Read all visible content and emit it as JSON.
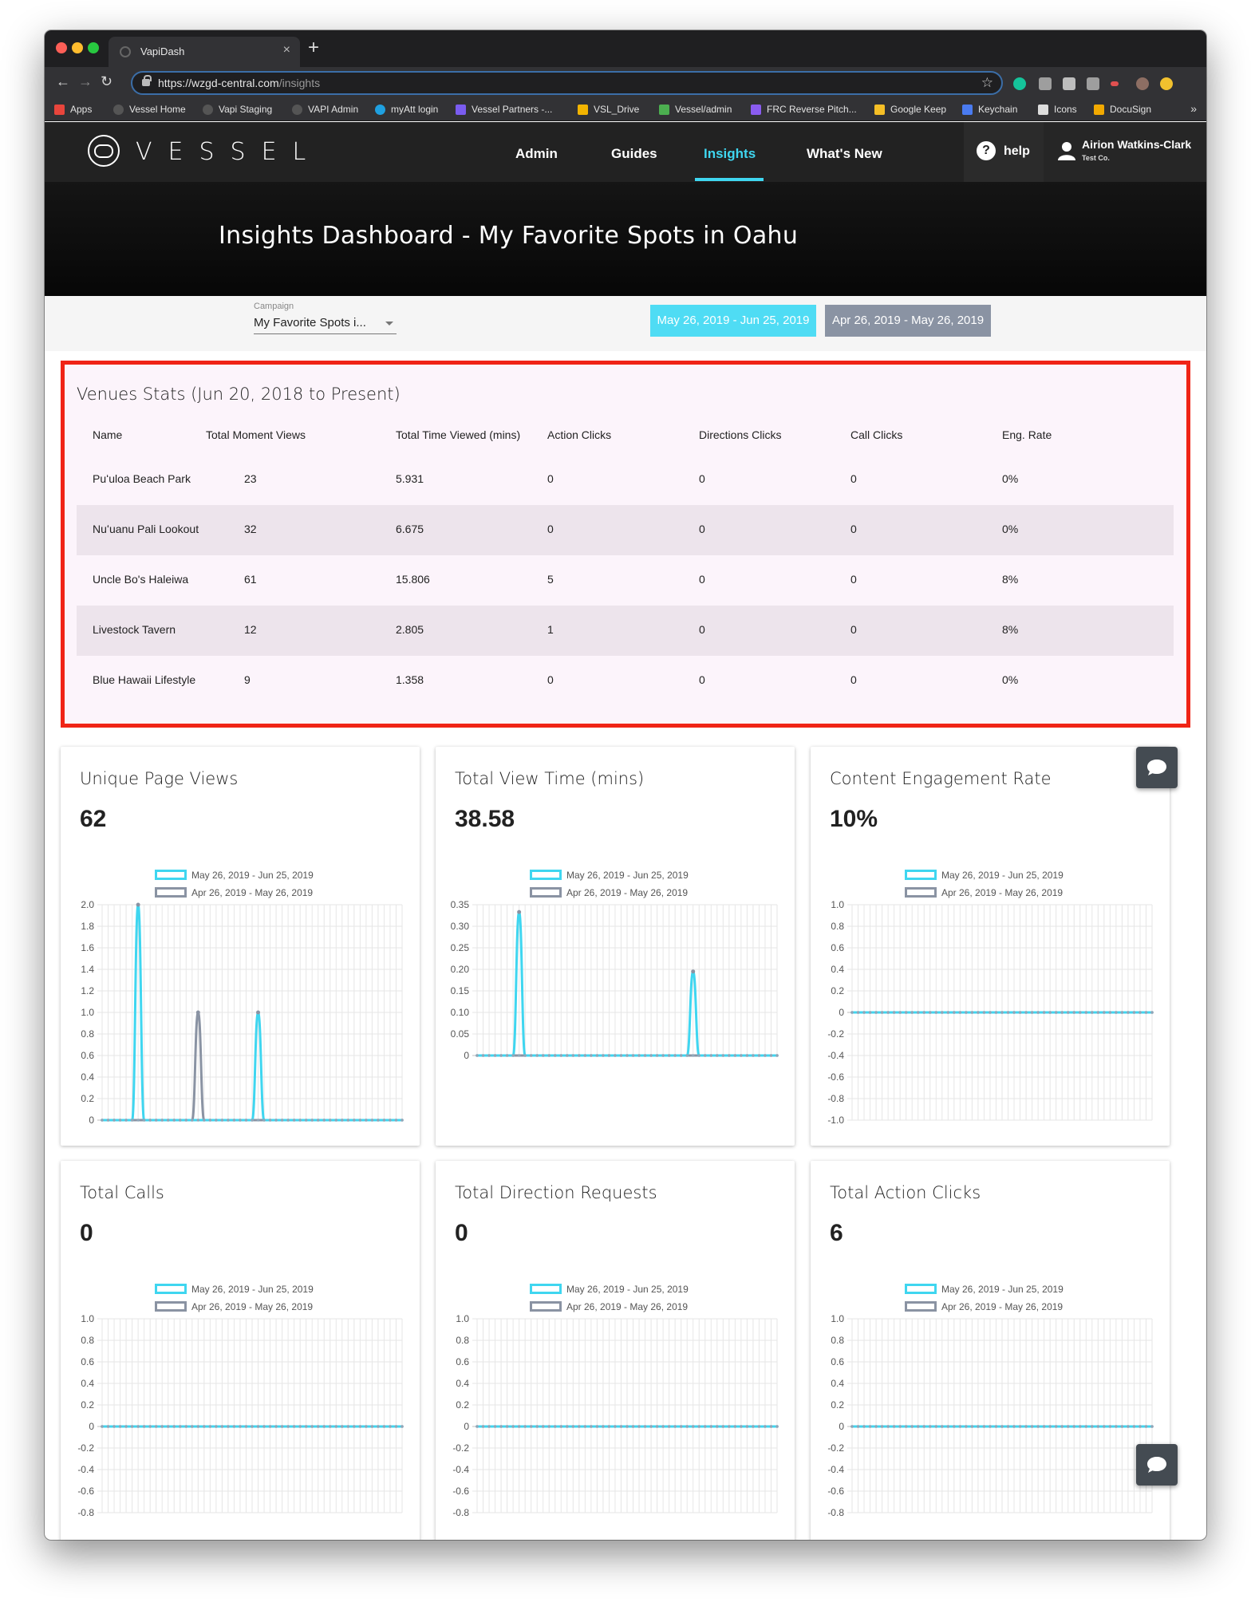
{
  "browser": {
    "tab_title": "VapiDash",
    "url_host": "https://wzgd-central.com",
    "url_path": "/insights",
    "bookmarks": [
      {
        "label": "Apps",
        "color": "#e8453c"
      },
      {
        "label": "Vessel Home",
        "color": "#555555"
      },
      {
        "label": "Vapi Staging",
        "color": "#555555"
      },
      {
        "label": "VAPI Admin",
        "color": "#555555"
      },
      {
        "label": "myAtt login",
        "color": "#1fa0e0"
      },
      {
        "label": "Vessel Partners -...",
        "color": "#7a5cf0"
      },
      {
        "label": "VSL_Drive",
        "color": "#f2b400"
      },
      {
        "label": "Vessel/admin",
        "color": "#4caf50"
      },
      {
        "label": "FRC Reverse Pitch...",
        "color": "#8a5cf0"
      },
      {
        "label": "Google Keep",
        "color": "#f6bf26"
      },
      {
        "label": "Keychain",
        "color": "#4a7bf0"
      },
      {
        "label": "Icons",
        "color": "#dddddd"
      },
      {
        "label": "DocuSign",
        "color": "#f2a900"
      }
    ]
  },
  "nav": {
    "brand": "VESSEL",
    "items": [
      "Admin",
      "Guides",
      "Insights",
      "What's New"
    ],
    "active": "Insights",
    "help_label": "help",
    "user_name": "Airion Watkins-Clark",
    "user_org": "Test Co."
  },
  "hero": {
    "title": "Insights Dashboard - My Favorite Spots in Oahu"
  },
  "filters": {
    "campaign_label": "Campaign",
    "campaign_value": "My Favorite Spots i...",
    "range_current": "May 26, 2019 - Jun 25, 2019",
    "range_previous": "Apr 26, 2019 - May 26, 2019"
  },
  "colors": {
    "accent": "#3fd6f0",
    "previous": "#8a93a3",
    "highlight_border": "#f02416"
  },
  "venues": {
    "title": "Venues Stats (Jun 20, 2018 to Present)",
    "columns": [
      "Name",
      "Total Moment Views",
      "Total Time Viewed (mins)",
      "Action Clicks",
      "Directions Clicks",
      "Call Clicks",
      "Eng. Rate"
    ],
    "rows": [
      [
        "Puʻuloa Beach Park",
        "23",
        "5.931",
        "0",
        "0",
        "0",
        "0%"
      ],
      [
        "Nuʻuanu Pali Lookout",
        "32",
        "6.675",
        "0",
        "0",
        "0",
        "0%"
      ],
      [
        "Uncle Bo's Haleiwa",
        "61",
        "15.806",
        "5",
        "0",
        "0",
        "8%"
      ],
      [
        "Livestock Tavern",
        "12",
        "2.805",
        "1",
        "0",
        "0",
        "8%"
      ],
      [
        "Blue Hawaii Lifestyle",
        "9",
        "1.358",
        "0",
        "0",
        "0",
        "0%"
      ]
    ]
  },
  "chart_data": [
    {
      "type": "line",
      "title": "Unique Page Views",
      "value": "62",
      "ylim": [
        0,
        2.0
      ],
      "yticks": [
        "2.0",
        "1.8",
        "1.6",
        "1.4",
        "1.2",
        "1.0",
        "0.8",
        "0.6",
        "0.4",
        "0.2",
        "0"
      ],
      "series": [
        {
          "name": "May 26, 2019 - Jun 25, 2019",
          "values": [
            0,
            0,
            0,
            0,
            0,
            0,
            2,
            0,
            0,
            0,
            0,
            0,
            0,
            0,
            0,
            0,
            0,
            0,
            0,
            0,
            0,
            0,
            0,
            0,
            0,
            0,
            1,
            0,
            0,
            0,
            0,
            0,
            0,
            0,
            0,
            0,
            0,
            0,
            0,
            0,
            0,
            0,
            0,
            0,
            0,
            0,
            0,
            0,
            0,
            0,
            0
          ]
        },
        {
          "name": "Apr 26, 2019 - May 26, 2019",
          "values": [
            0,
            0,
            0,
            0,
            0,
            0,
            0,
            0,
            0,
            0,
            0,
            0,
            0,
            0,
            0,
            0,
            1,
            0,
            0,
            0,
            0,
            0,
            0,
            0,
            0,
            0,
            0,
            0,
            0,
            0,
            0,
            0,
            0,
            0,
            0,
            0,
            0,
            0,
            0,
            0,
            0,
            0,
            0,
            0,
            0,
            0,
            0,
            0,
            0,
            0,
            0
          ]
        }
      ]
    },
    {
      "type": "line",
      "title": "Total View Time (mins)",
      "value": "38.58",
      "ylim": [
        0,
        0.35
      ],
      "yticks": [
        "0.35",
        "0.30",
        "0.25",
        "0.20",
        "0.15",
        "0.10",
        "0.05",
        "0"
      ],
      "series": [
        {
          "name": "May 26, 2019 - Jun 25, 2019",
          "values": [
            0,
            0,
            0,
            0,
            0,
            0,
            0,
            0.333,
            0,
            0,
            0,
            0,
            0,
            0,
            0,
            0,
            0,
            0,
            0,
            0,
            0,
            0,
            0,
            0,
            0,
            0,
            0,
            0,
            0,
            0,
            0,
            0,
            0,
            0,
            0,
            0,
            0.195,
            0,
            0,
            0,
            0,
            0,
            0,
            0,
            0,
            0,
            0,
            0,
            0,
            0,
            0
          ]
        },
        {
          "name": "Apr 26, 2019 - May 26, 2019",
          "values": [
            0,
            0,
            0,
            0,
            0,
            0,
            0,
            0,
            0,
            0,
            0,
            0,
            0,
            0,
            0,
            0,
            0,
            0,
            0,
            0,
            0,
            0,
            0,
            0,
            0,
            0,
            0,
            0,
            0,
            0,
            0,
            0,
            0,
            0,
            0,
            0,
            0,
            0,
            0,
            0,
            0,
            0,
            0,
            0,
            0,
            0,
            0,
            0,
            0,
            0,
            0
          ]
        }
      ]
    },
    {
      "type": "line",
      "title": "Content Engagement Rate",
      "value": "10%",
      "ylim": [
        -1.0,
        1.0
      ],
      "yticks": [
        "1.0",
        "0.8",
        "0.6",
        "0.4",
        "0.2",
        "0",
        "-0.2",
        "-0.4",
        "-0.6",
        "-0.8",
        "-1.0"
      ],
      "series": [
        {
          "name": "May 26, 2019 - Jun 25, 2019",
          "values": [
            0,
            0,
            0,
            0,
            0,
            0,
            0,
            0,
            0,
            0,
            0,
            0,
            0,
            0,
            0,
            0,
            0,
            0,
            0,
            0,
            0,
            0,
            0,
            0,
            0,
            0,
            0,
            0,
            0,
            0,
            0,
            0,
            0,
            0,
            0,
            0,
            0,
            0,
            0,
            0,
            0,
            0,
            0,
            0,
            0,
            0,
            0,
            0,
            0,
            0,
            0
          ]
        },
        {
          "name": "Apr 26, 2019 - May 26, 2019",
          "values": [
            0,
            0,
            0,
            0,
            0,
            0,
            0,
            0,
            0,
            0,
            0,
            0,
            0,
            0,
            0,
            0,
            0,
            0,
            0,
            0,
            0,
            0,
            0,
            0,
            0,
            0,
            0,
            0,
            0,
            0,
            0,
            0,
            0,
            0,
            0,
            0,
            0,
            0,
            0,
            0,
            0,
            0,
            0,
            0,
            0,
            0,
            0,
            0,
            0,
            0,
            0
          ]
        }
      ]
    },
    {
      "type": "line",
      "title": "Total Calls",
      "value": "0",
      "ylim": [
        -1.0,
        1.0
      ],
      "yticks": [
        "1.0",
        "0.8",
        "0.6",
        "0.4",
        "0.2",
        "0",
        "-0.2",
        "-0.4",
        "-0.6",
        "-0.8"
      ],
      "series": [
        {
          "name": "May 26, 2019 - Jun 25, 2019",
          "values": [
            0,
            0,
            0,
            0,
            0,
            0,
            0,
            0,
            0,
            0,
            0,
            0,
            0,
            0,
            0,
            0,
            0,
            0,
            0,
            0,
            0,
            0,
            0,
            0,
            0,
            0,
            0,
            0,
            0,
            0,
            0,
            0,
            0,
            0,
            0,
            0,
            0,
            0,
            0,
            0,
            0,
            0,
            0,
            0,
            0,
            0,
            0,
            0,
            0,
            0,
            0
          ]
        },
        {
          "name": "Apr 26, 2019 - May 26, 2019",
          "values": [
            0,
            0,
            0,
            0,
            0,
            0,
            0,
            0,
            0,
            0,
            0,
            0,
            0,
            0,
            0,
            0,
            0,
            0,
            0,
            0,
            0,
            0,
            0,
            0,
            0,
            0,
            0,
            0,
            0,
            0,
            0,
            0,
            0,
            0,
            0,
            0,
            0,
            0,
            0,
            0,
            0,
            0,
            0,
            0,
            0,
            0,
            0,
            0,
            0,
            0,
            0
          ]
        }
      ]
    },
    {
      "type": "line",
      "title": "Total Direction Requests",
      "value": "0",
      "ylim": [
        -1.0,
        1.0
      ],
      "yticks": [
        "1.0",
        "0.8",
        "0.6",
        "0.4",
        "0.2",
        "0",
        "-0.2",
        "-0.4",
        "-0.6",
        "-0.8"
      ],
      "series": [
        {
          "name": "May 26, 2019 - Jun 25, 2019",
          "values": [
            0,
            0,
            0,
            0,
            0,
            0,
            0,
            0,
            0,
            0,
            0,
            0,
            0,
            0,
            0,
            0,
            0,
            0,
            0,
            0,
            0,
            0,
            0,
            0,
            0,
            0,
            0,
            0,
            0,
            0,
            0,
            0,
            0,
            0,
            0,
            0,
            0,
            0,
            0,
            0,
            0,
            0,
            0,
            0,
            0,
            0,
            0,
            0,
            0,
            0,
            0
          ]
        },
        {
          "name": "Apr 26, 2019 - May 26, 2019",
          "values": [
            0,
            0,
            0,
            0,
            0,
            0,
            0,
            0,
            0,
            0,
            0,
            0,
            0,
            0,
            0,
            0,
            0,
            0,
            0,
            0,
            0,
            0,
            0,
            0,
            0,
            0,
            0,
            0,
            0,
            0,
            0,
            0,
            0,
            0,
            0,
            0,
            0,
            0,
            0,
            0,
            0,
            0,
            0,
            0,
            0,
            0,
            0,
            0,
            0,
            0,
            0
          ]
        }
      ]
    },
    {
      "type": "line",
      "title": "Total Action Clicks",
      "value": "6",
      "ylim": [
        -1.0,
        1.0
      ],
      "yticks": [
        "1.0",
        "0.8",
        "0.6",
        "0.4",
        "0.2",
        "0",
        "-0.2",
        "-0.4",
        "-0.6",
        "-0.8"
      ],
      "series": [
        {
          "name": "May 26, 2019 - Jun 25, 2019",
          "values": [
            0,
            0,
            0,
            0,
            0,
            0,
            0,
            0,
            0,
            0,
            0,
            0,
            0,
            0,
            0,
            0,
            0,
            0,
            0,
            0,
            0,
            0,
            0,
            0,
            0,
            0,
            0,
            0,
            0,
            0,
            0,
            0,
            0,
            0,
            0,
            0,
            0,
            0,
            0,
            0,
            0,
            0,
            0,
            0,
            0,
            0,
            0,
            0,
            0,
            0,
            0
          ]
        },
        {
          "name": "Apr 26, 2019 - May 26, 2019",
          "values": [
            0,
            0,
            0,
            0,
            0,
            0,
            0,
            0,
            0,
            0,
            0,
            0,
            0,
            0,
            0,
            0,
            0,
            0,
            0,
            0,
            0,
            0,
            0,
            0,
            0,
            0,
            0,
            0,
            0,
            0,
            0,
            0,
            0,
            0,
            0,
            0,
            0,
            0,
            0,
            0,
            0,
            0,
            0,
            0,
            0,
            0,
            0,
            0,
            0,
            0,
            0
          ]
        }
      ]
    }
  ]
}
